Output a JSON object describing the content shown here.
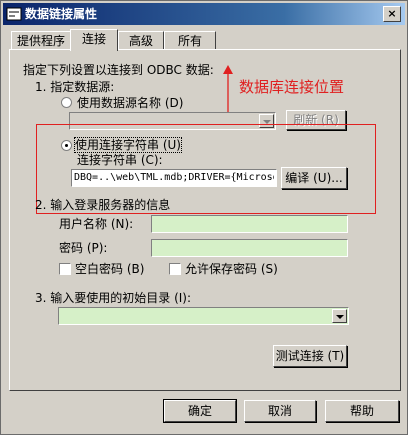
{
  "window": {
    "title": "数据链接属性",
    "close_glyph": "×"
  },
  "tabs": [
    "提供程序",
    "连接",
    "高级",
    "所有"
  ],
  "intro": "指定下列设置以连接到 ODBC 数据:",
  "section1": {
    "label": "1. 指定数据源:",
    "radio_dsn": "使用数据源名称 (D)",
    "refresh_button": "刷新 (R)",
    "radio_connstr": "使用连接字符串 (U)",
    "connstr_label": "连接字符串 (C):",
    "connstr_value": "DBQ=..\\web\\TML.mdb;DRIVER={Microsoft",
    "compile_button": "编译 (U)..."
  },
  "annotation": "数据库连接位置",
  "section2": {
    "label": "2. 输入登录服务器的信息",
    "username_label": "用户名称 (N):",
    "password_label": "密码 (P):",
    "blank_password": "空白密码 (B)",
    "allow_save_password": "允许保存密码 (S)"
  },
  "section3": {
    "label": "3. 输入要使用的初始目录 (I):"
  },
  "test_button": "测试连接 (T)",
  "footer": {
    "ok": "确定",
    "cancel": "取消",
    "help": "帮助"
  },
  "colors": {
    "annotation_red": "#e02020",
    "field_green": "#d6f0c8",
    "title_blue": "#0a246a"
  }
}
